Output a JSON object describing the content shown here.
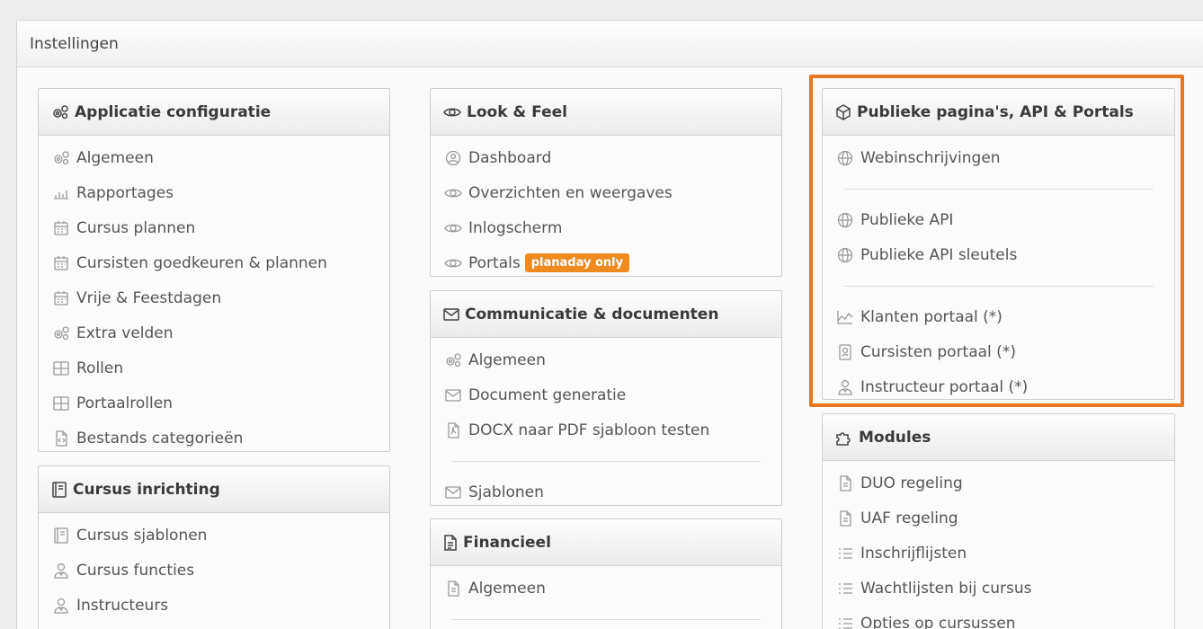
{
  "page": {
    "title": "Instellingen"
  },
  "panels": {
    "applicatie": {
      "title": "Applicatie configuratie",
      "items": [
        "Algemeen",
        "Rapportages",
        "Cursus plannen",
        "Cursisten goedkeuren & plannen",
        "Vrije & Feestdagen",
        "Extra velden",
        "Rollen",
        "Portaalrollen",
        "Bestands categorieën"
      ]
    },
    "cursus": {
      "title": "Cursus inrichting",
      "items": [
        "Cursus sjablonen",
        "Cursus functies",
        "Instructeurs"
      ]
    },
    "look": {
      "title": "Look & Feel",
      "items": [
        "Dashboard",
        "Overzichten en weergaves",
        "Inlogscherm",
        "Portals"
      ],
      "badge": "planaday only"
    },
    "communicatie": {
      "title": "Communicatie & documenten",
      "items": [
        "Algemeen",
        "Document generatie",
        "DOCX naar PDF sjabloon testen",
        "Sjablonen"
      ]
    },
    "financieel": {
      "title": "Financieel",
      "items": [
        "Algemeen"
      ]
    },
    "publiek": {
      "title": "Publieke pagina's, API & Portals",
      "items": [
        "Webinschrijvingen",
        "Publieke API",
        "Publieke API sleutels",
        "Klanten portaal (*)",
        "Cursisten portaal (*)",
        "Instructeur portaal (*)"
      ]
    },
    "modules": {
      "title": "Modules",
      "items": [
        "DUO regeling",
        "UAF regeling",
        "Inschrijflijsten",
        "Wachtlijsten bij cursus",
        "Opties op cursussen"
      ]
    }
  },
  "colors": {
    "highlight": "#e87722",
    "badge": "#ee8a1e"
  }
}
